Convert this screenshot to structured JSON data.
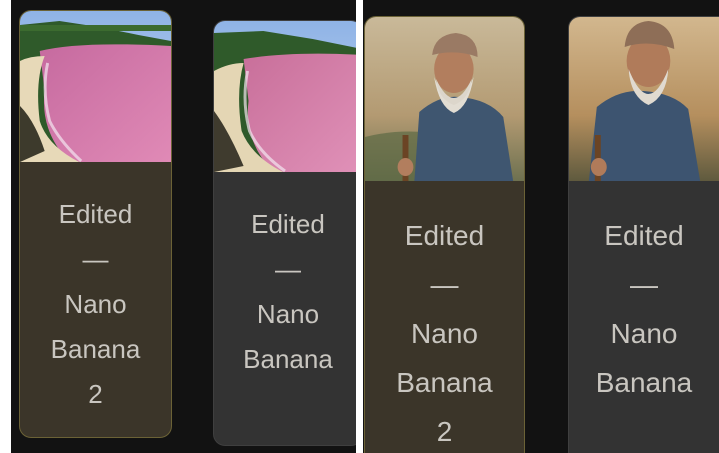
{
  "cards": {
    "left_selected": {
      "label_top": "Edited",
      "separator": "—",
      "label_model": "Nano",
      "label_model2": "Banana",
      "version": "2",
      "image": "pink-beach-bay-image"
    },
    "left_normal": {
      "label_top": "Edited",
      "separator": "—",
      "label_model": "Nano",
      "label_model2": "Banana",
      "image": "pink-beach-bay-image"
    },
    "right_selected": {
      "label_top": "Edited",
      "separator": "—",
      "label_model": "Nano",
      "label_model2": "Banana",
      "version": "2",
      "image": "old-man-portrait-image"
    },
    "right_normal": {
      "label_top": "Edited",
      "separator": "—",
      "label_model": "Nano",
      "label_model2": "Banana",
      "image": "old-man-portrait-image"
    }
  },
  "colors": {
    "background": "#121212",
    "selected_card": "#3b3529",
    "selected_border": "#6b6236",
    "normal_card": "#333333",
    "text": "#c9c6c0"
  }
}
